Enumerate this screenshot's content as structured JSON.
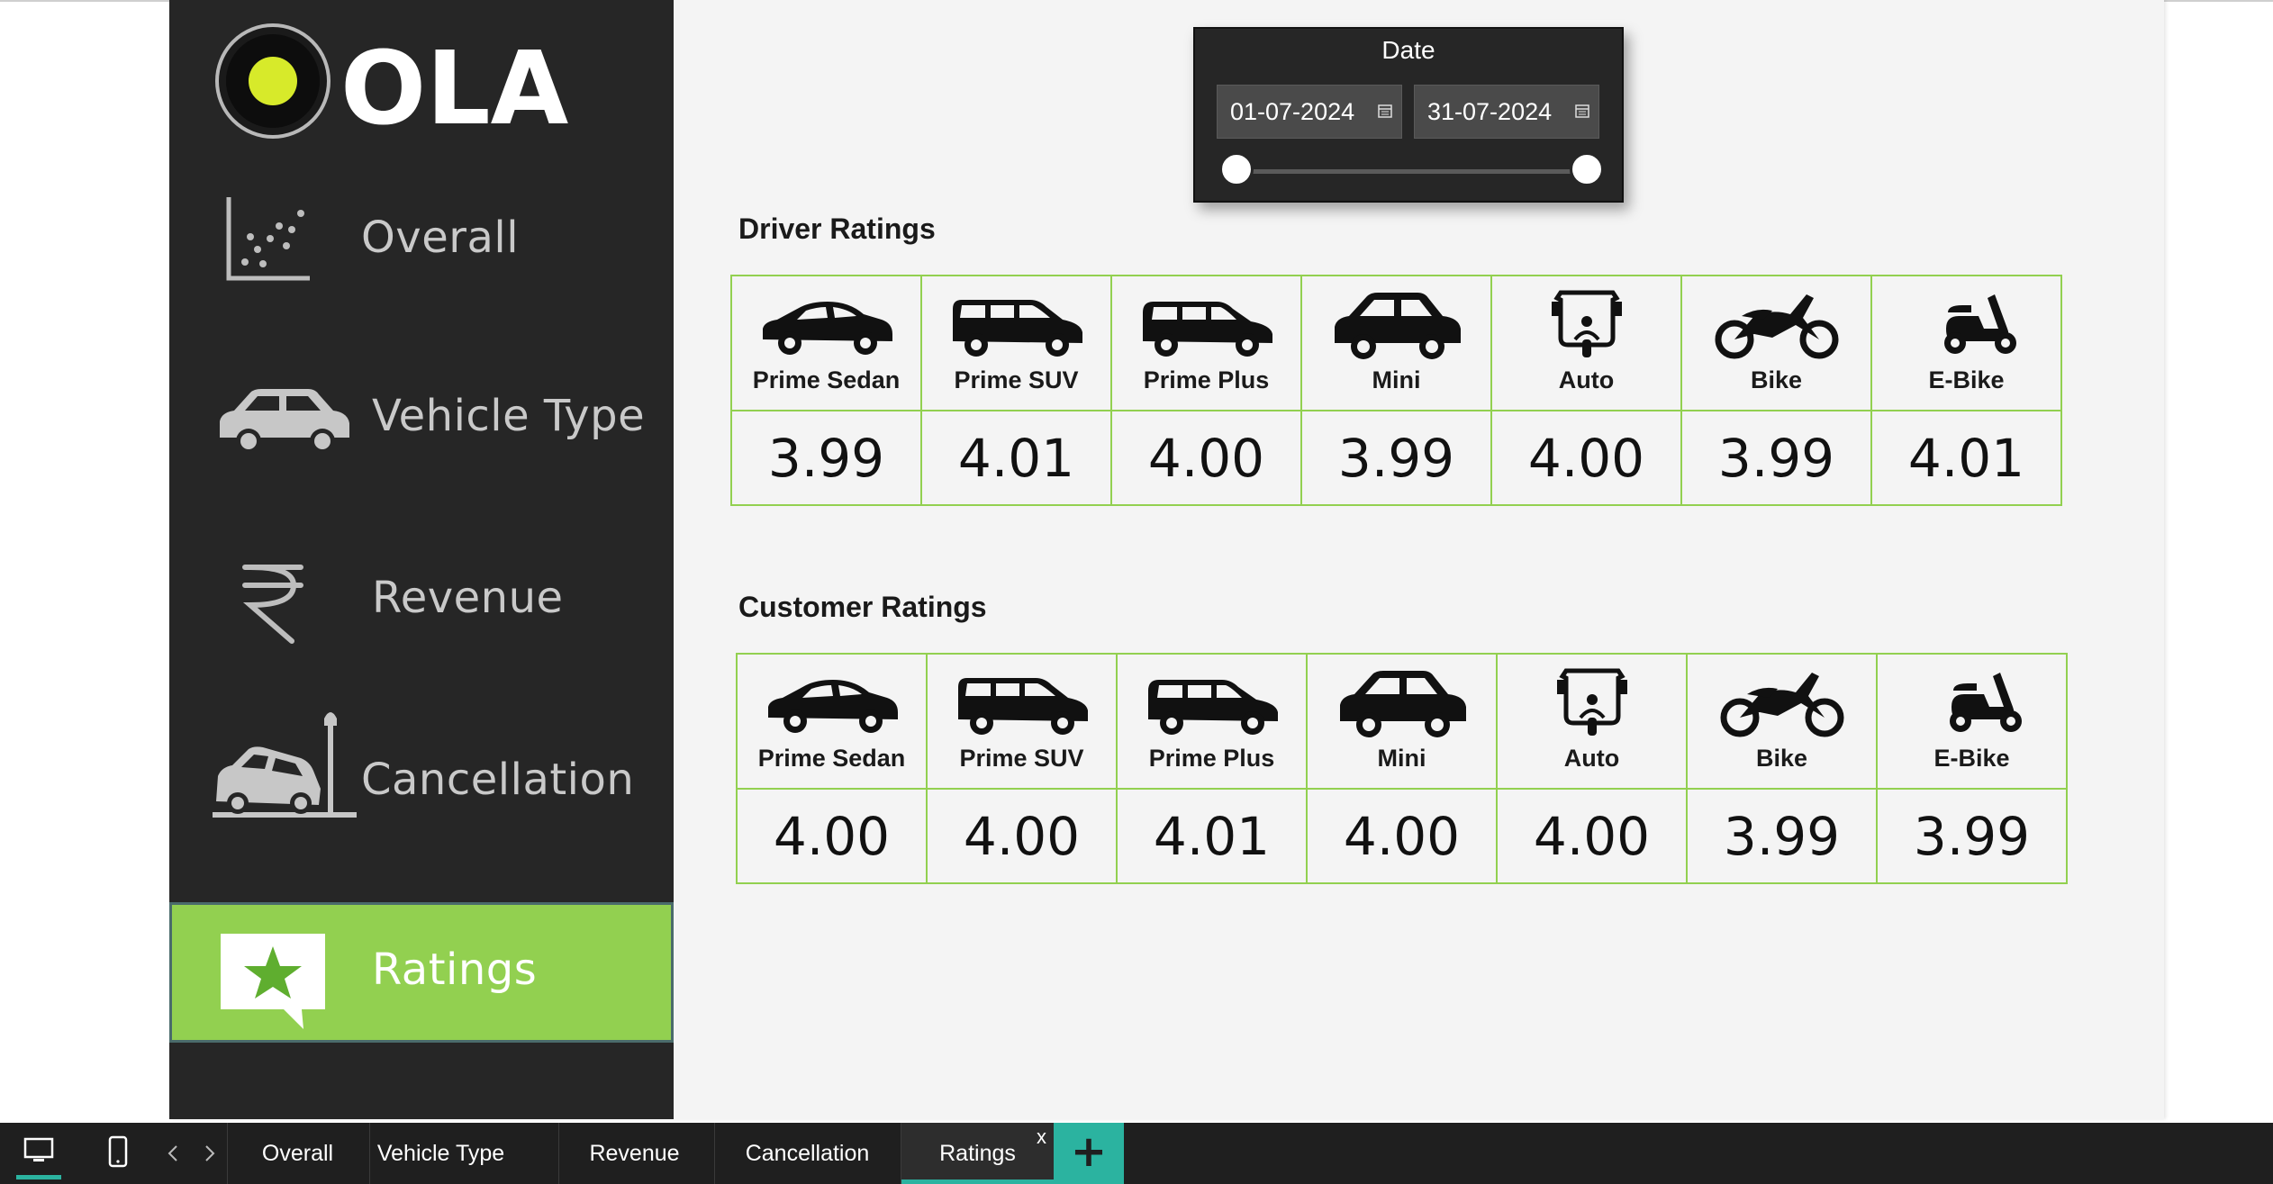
{
  "brand": {
    "name": "OLA"
  },
  "sidebar": {
    "items": [
      {
        "label": "Overall",
        "icon": "scatter-chart-icon",
        "active": false
      },
      {
        "label": "Vehicle Type",
        "icon": "car-icon",
        "active": false
      },
      {
        "label": "Revenue",
        "icon": "rupee-icon",
        "active": false
      },
      {
        "label": "Cancellation",
        "icon": "car-crash-icon",
        "active": false
      },
      {
        "label": "Ratings",
        "icon": "star-chat-icon",
        "active": true
      }
    ],
    "active_color": "#92d050"
  },
  "date_slicer": {
    "title": "Date",
    "start": "01-07-2024",
    "end": "31-07-2024"
  },
  "driver_ratings": {
    "title": "Driver Ratings",
    "vehicles": [
      "Prime Sedan",
      "Prime SUV",
      "Prime Plus",
      "Mini",
      "Auto",
      "Bike",
      "E-Bike"
    ],
    "values": [
      "3.99",
      "4.01",
      "4.00",
      "3.99",
      "4.00",
      "3.99",
      "4.01"
    ]
  },
  "customer_ratings": {
    "title": "Customer Ratings",
    "vehicles": [
      "Prime Sedan",
      "Prime SUV",
      "Prime Plus",
      "Mini",
      "Auto",
      "Bike",
      "E-Bike"
    ],
    "values": [
      "4.00",
      "4.00",
      "4.01",
      "4.00",
      "4.00",
      "3.99",
      "3.99"
    ]
  },
  "tabs": {
    "items": [
      "Overall",
      "Vehicle Type",
      "Revenue",
      "Cancellation",
      "Ratings"
    ],
    "active": "Ratings",
    "close_label": "x",
    "add_label": "+"
  },
  "colors": {
    "accent_green": "#92d050",
    "teal": "#2bb3a0",
    "sidebar_bg": "#262626"
  }
}
